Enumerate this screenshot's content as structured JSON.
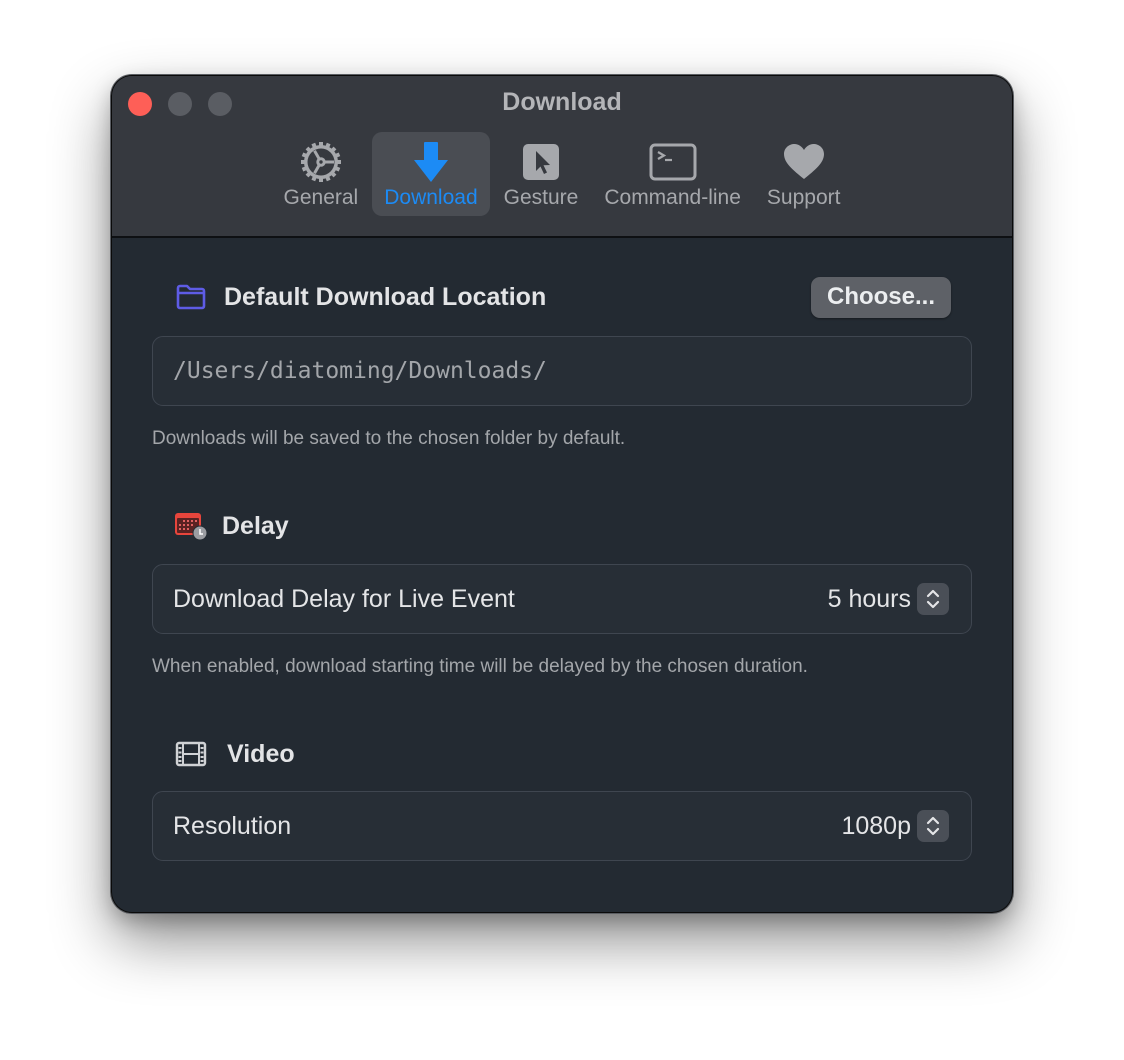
{
  "window": {
    "title": "Download",
    "traffic_lights": {
      "close_color": "#fe5f57",
      "inactive_color": "#5a5d63"
    }
  },
  "toolbar": {
    "items": [
      {
        "label": "General",
        "icon": "gear-icon",
        "active": false
      },
      {
        "label": "Download",
        "icon": "download-arrow-icon",
        "active": true
      },
      {
        "label": "Gesture",
        "icon": "cursor-icon",
        "active": false
      },
      {
        "label": "Command-line",
        "icon": "terminal-icon",
        "active": false
      },
      {
        "label": "Support",
        "icon": "heart-icon",
        "active": false
      }
    ],
    "accent_color": "#1c8bf5"
  },
  "sections": {
    "location": {
      "title": "Default Download Location",
      "icon": "folder-icon",
      "icon_color": "#5e5ce6",
      "choose_label": "Choose...",
      "path_value": "/Users/diatoming/Downloads/",
      "help": "Downloads will be saved to the chosen folder by default."
    },
    "delay": {
      "title": "Delay",
      "icon": "calendar-clock-icon",
      "icon_color": "#e8453c",
      "row_label": "Download Delay for Live Event",
      "selected_value": "5 hours",
      "help": "When enabled, download starting time will be delayed by the chosen duration."
    },
    "video": {
      "title": "Video",
      "icon": "film-icon",
      "row_label": "Resolution",
      "selected_value": "1080p"
    }
  }
}
